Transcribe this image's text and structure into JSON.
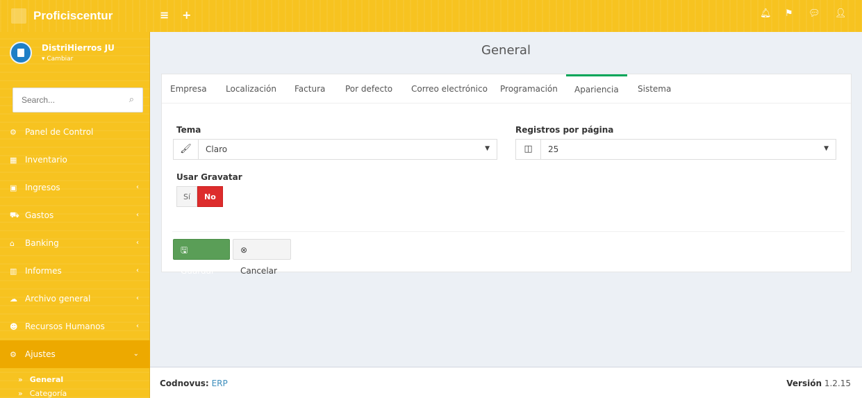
{
  "app": {
    "brand": "Proficiscentur"
  },
  "topbar": {
    "icons": [
      "menu-icon",
      "plus-icon",
      "bell-icon",
      "flag-icon",
      "chat-icon",
      "user-icon"
    ]
  },
  "user": {
    "name": "DistriHierros JU",
    "switch_label": "▾ Cambiar"
  },
  "search": {
    "placeholder": "Search..."
  },
  "nav": {
    "items": [
      {
        "label": "Panel de Control"
      },
      {
        "label": "Inventario"
      },
      {
        "label": "Ingresos"
      },
      {
        "label": "Gastos"
      },
      {
        "label": "Banking"
      },
      {
        "label": "Informes"
      },
      {
        "label": "Archivo general"
      },
      {
        "label": "Recursos Humanos"
      },
      {
        "label": "Ajustes"
      }
    ],
    "subitems": [
      {
        "label": "General"
      },
      {
        "label": "Categoría"
      }
    ]
  },
  "page": {
    "title": "General"
  },
  "tabs": [
    {
      "label": "Empresa"
    },
    {
      "label": "Localización"
    },
    {
      "label": "Factura"
    },
    {
      "label": "Por defecto"
    },
    {
      "label": "Correo electrónico"
    },
    {
      "label": "Programación"
    },
    {
      "label": "Apariencia"
    },
    {
      "label": "Sistema"
    }
  ],
  "form": {
    "tema_label": "Tema",
    "tema_value": "Claro",
    "registros_label": "Registros por página",
    "registros_value": "25",
    "gravatar_label": "Usar Gravatar",
    "gravatar_yes": "Sí",
    "gravatar_no": "No"
  },
  "buttons": {
    "save": "Guardar",
    "cancel": "Cancelar"
  },
  "footer": {
    "company": "Codnovus:",
    "link": "ERP",
    "version_label": "Versión",
    "version": "1.2.15"
  },
  "colors": {
    "accent": "#f7c320",
    "success": "#5a9e57",
    "danger": "#dd2c2c",
    "tab_active": "#00a65a"
  }
}
